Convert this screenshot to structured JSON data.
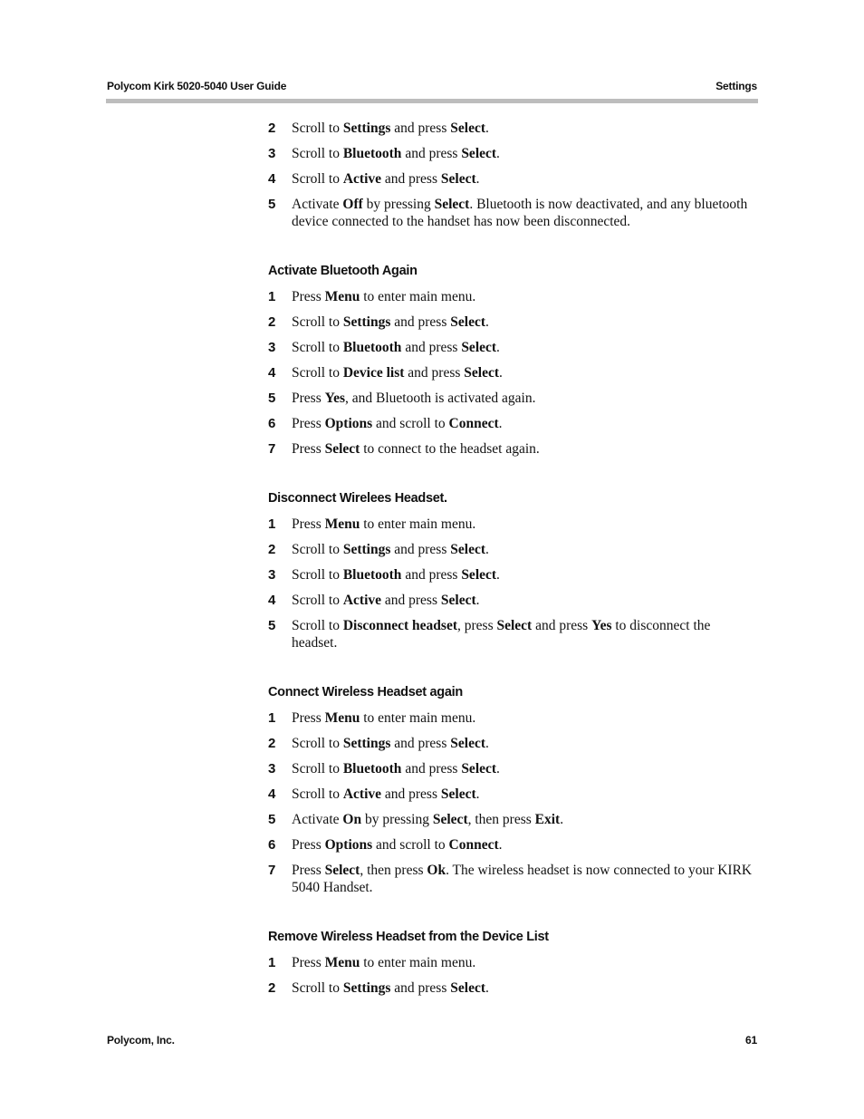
{
  "header": {
    "title": "Polycom Kirk 5020-5040 User Guide",
    "section": "Settings"
  },
  "footer": {
    "company": "Polycom, Inc.",
    "page_number": "61"
  },
  "sections": [
    {
      "heading": "",
      "steps": [
        {
          "num": "2",
          "parts": [
            {
              "t": "Scroll to "
            },
            {
              "t": "Settings",
              "b": true
            },
            {
              "t": " and press "
            },
            {
              "t": "Select",
              "b": true
            },
            {
              "t": "."
            }
          ]
        },
        {
          "num": "3",
          "parts": [
            {
              "t": "Scroll to "
            },
            {
              "t": "Bluetooth",
              "b": true
            },
            {
              "t": " and press "
            },
            {
              "t": "Select",
              "b": true
            },
            {
              "t": "."
            }
          ]
        },
        {
          "num": "4",
          "parts": [
            {
              "t": "Scroll to "
            },
            {
              "t": "Active",
              "b": true
            },
            {
              "t": " and press "
            },
            {
              "t": "Select",
              "b": true
            },
            {
              "t": "."
            }
          ]
        },
        {
          "num": "5",
          "parts": [
            {
              "t": "Activate "
            },
            {
              "t": "Off",
              "b": true
            },
            {
              "t": " by pressing "
            },
            {
              "t": "Select",
              "b": true
            },
            {
              "t": ". Bluetooth is now deactivated, and any bluetooth device connected to the handset has now been disconnected."
            }
          ]
        }
      ]
    },
    {
      "heading": "Activate Bluetooth Again",
      "steps": [
        {
          "num": "1",
          "parts": [
            {
              "t": "Press "
            },
            {
              "t": "Menu",
              "b": true
            },
            {
              "t": " to enter main menu."
            }
          ]
        },
        {
          "num": "2",
          "parts": [
            {
              "t": "Scroll to "
            },
            {
              "t": "Settings",
              "b": true
            },
            {
              "t": " and press "
            },
            {
              "t": "Select",
              "b": true
            },
            {
              "t": "."
            }
          ]
        },
        {
          "num": "3",
          "parts": [
            {
              "t": "Scroll to "
            },
            {
              "t": "Bluetooth",
              "b": true
            },
            {
              "t": " and press "
            },
            {
              "t": "Select",
              "b": true
            },
            {
              "t": "."
            }
          ]
        },
        {
          "num": "4",
          "parts": [
            {
              "t": "Scroll to "
            },
            {
              "t": "Device list",
              "b": true
            },
            {
              "t": " and press "
            },
            {
              "t": "Select",
              "b": true
            },
            {
              "t": "."
            }
          ]
        },
        {
          "num": "5",
          "parts": [
            {
              "t": "Press "
            },
            {
              "t": "Yes",
              "b": true
            },
            {
              "t": ", and Bluetooth is activated again."
            }
          ]
        },
        {
          "num": "6",
          "parts": [
            {
              "t": "Press "
            },
            {
              "t": "Options",
              "b": true
            },
            {
              "t": " and scroll to "
            },
            {
              "t": "Connect",
              "b": true
            },
            {
              "t": "."
            }
          ]
        },
        {
          "num": "7",
          "parts": [
            {
              "t": "Press "
            },
            {
              "t": "Select",
              "b": true
            },
            {
              "t": " to connect to the headset again."
            }
          ]
        }
      ]
    },
    {
      "heading": "Disconnect Wirelees Headset.",
      "steps": [
        {
          "num": "1",
          "parts": [
            {
              "t": "Press "
            },
            {
              "t": "Menu",
              "b": true
            },
            {
              "t": " to enter main menu."
            }
          ]
        },
        {
          "num": "2",
          "parts": [
            {
              "t": "Scroll to "
            },
            {
              "t": "Settings",
              "b": true
            },
            {
              "t": " and press "
            },
            {
              "t": "Select",
              "b": true
            },
            {
              "t": "."
            }
          ]
        },
        {
          "num": "3",
          "parts": [
            {
              "t": "Scroll to "
            },
            {
              "t": "Bluetooth",
              "b": true
            },
            {
              "t": " and press "
            },
            {
              "t": "Select",
              "b": true
            },
            {
              "t": "."
            }
          ]
        },
        {
          "num": "4",
          "parts": [
            {
              "t": "Scroll to "
            },
            {
              "t": "Active",
              "b": true
            },
            {
              "t": " and press "
            },
            {
              "t": "Select",
              "b": true
            },
            {
              "t": "."
            }
          ]
        },
        {
          "num": "5",
          "parts": [
            {
              "t": "Scroll to "
            },
            {
              "t": "Disconnect headset",
              "b": true
            },
            {
              "t": ", press "
            },
            {
              "t": "Select",
              "b": true
            },
            {
              "t": " and press "
            },
            {
              "t": "Yes",
              "b": true
            },
            {
              "t": " to disconnect the headset."
            }
          ]
        }
      ]
    },
    {
      "heading": "Connect Wireless Headset again",
      "steps": [
        {
          "num": "1",
          "parts": [
            {
              "t": "Press "
            },
            {
              "t": "Menu",
              "b": true
            },
            {
              "t": " to enter main menu."
            }
          ]
        },
        {
          "num": "2",
          "parts": [
            {
              "t": "Scroll to "
            },
            {
              "t": "Settings",
              "b": true
            },
            {
              "t": " and press "
            },
            {
              "t": "Select",
              "b": true
            },
            {
              "t": "."
            }
          ]
        },
        {
          "num": "3",
          "parts": [
            {
              "t": "Scroll to "
            },
            {
              "t": "Bluetooth",
              "b": true
            },
            {
              "t": " and press "
            },
            {
              "t": "Select",
              "b": true
            },
            {
              "t": "."
            }
          ]
        },
        {
          "num": "4",
          "parts": [
            {
              "t": "Scroll to "
            },
            {
              "t": "Active",
              "b": true
            },
            {
              "t": " and press "
            },
            {
              "t": "Select",
              "b": true
            },
            {
              "t": "."
            }
          ]
        },
        {
          "num": "5",
          "parts": [
            {
              "t": "Activate "
            },
            {
              "t": "On",
              "b": true
            },
            {
              "t": " by pressing "
            },
            {
              "t": "Select",
              "b": true
            },
            {
              "t": ", then press "
            },
            {
              "t": "Exit",
              "b": true
            },
            {
              "t": "."
            }
          ]
        },
        {
          "num": "6",
          "parts": [
            {
              "t": "Press "
            },
            {
              "t": "Options",
              "b": true
            },
            {
              "t": " and scroll to "
            },
            {
              "t": "Connect",
              "b": true
            },
            {
              "t": "."
            }
          ]
        },
        {
          "num": "7",
          "parts": [
            {
              "t": "Press "
            },
            {
              "t": "Select",
              "b": true
            },
            {
              "t": ", then press "
            },
            {
              "t": "Ok",
              "b": true
            },
            {
              "t": ". The wireless headset is now connected to your KIRK 5040 Handset."
            }
          ]
        }
      ]
    },
    {
      "heading": "Remove Wireless Headset from the Device List",
      "steps": [
        {
          "num": "1",
          "parts": [
            {
              "t": "Press "
            },
            {
              "t": "Menu",
              "b": true
            },
            {
              "t": " to enter main menu."
            }
          ]
        },
        {
          "num": "2",
          "parts": [
            {
              "t": "Scroll to "
            },
            {
              "t": "Settings",
              "b": true
            },
            {
              "t": " and press "
            },
            {
              "t": "Select",
              "b": true
            },
            {
              "t": "."
            }
          ]
        }
      ]
    }
  ]
}
